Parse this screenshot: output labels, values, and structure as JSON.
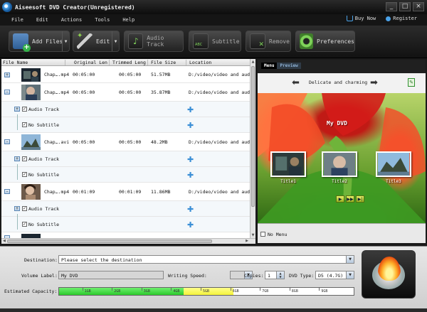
{
  "app": {
    "title": "Aiseesoft DVD Creator(Unregistered)"
  },
  "window_controls": {
    "minimize": "_",
    "maximize": "□",
    "close": "×"
  },
  "menu": {
    "items": [
      "File",
      "Edit",
      "Actions",
      "Tools",
      "Help"
    ],
    "buy_now": "Buy Now",
    "register": "Register"
  },
  "toolbar": {
    "add_files": "Add Files",
    "edit": "Edit",
    "audio_track": "Audio Track",
    "subtitle": "Subtitle",
    "remove": "Remove",
    "preferences": "Preferences"
  },
  "list": {
    "columns": [
      "File Name",
      "Original Len",
      "Trimmed Leng",
      "File Size",
      "Location"
    ],
    "rows": [
      {
        "kind": "file",
        "expander": "+",
        "name": "Chap….mp4",
        "original": "00:05:00",
        "trimmed": "00:05:00",
        "size": "51.57MB",
        "location": "D:/video/video and audi"
      },
      {
        "kind": "file",
        "expander": "–",
        "name": "Chap….mp4",
        "original": "00:05:00",
        "trimmed": "00:05:00",
        "size": "35.87MB",
        "location": "D:/video/video and audi"
      },
      {
        "kind": "track",
        "expander": "+",
        "label": "Audio Track"
      },
      {
        "kind": "track",
        "expander": "",
        "label": "No Subtitle"
      },
      {
        "kind": "file",
        "expander": "–",
        "name": "Chap….avi",
        "original": "00:05:00",
        "trimmed": "00:05:00",
        "size": "48.2MB",
        "location": "D:/video/video and audi"
      },
      {
        "kind": "track",
        "expander": "+",
        "label": "Audio Track"
      },
      {
        "kind": "track",
        "expander": "",
        "label": "No Subtitle"
      },
      {
        "kind": "file",
        "expander": "–",
        "name": "Chap….mp4",
        "original": "00:01:09",
        "trimmed": "00:01:09",
        "size": "11.86MB",
        "location": "D:/video/video and audi"
      },
      {
        "kind": "track",
        "expander": "+",
        "label": "Audio Track"
      },
      {
        "kind": "track",
        "expander": "",
        "label": "No Subtitle"
      }
    ]
  },
  "preview": {
    "tab_menu": "Menu",
    "tab_preview": "Preview",
    "template_name": "Delicate and charming",
    "dvd_title": "My DVD",
    "thumb_labels": [
      "Title1",
      "Title2",
      "Title3"
    ],
    "no_menu": "No Menu"
  },
  "bottom": {
    "destination_label": "Destination:",
    "destination_placeholder": "Please select the destination",
    "volume_label": "Volume Label:",
    "volume_value": "My DVD",
    "writing_speed_label": "Writing Speed:",
    "writing_speed_value": "",
    "copies_label": "Copies:",
    "copies_value": "1",
    "dvd_type_label": "DVD Type:",
    "dvd_type_value": "D5 (4.7G)",
    "estimated_capacity_label": "Estimated Capacity:",
    "capacity_ticks": [
      "1GB",
      "2GB",
      "3GB",
      "4GB",
      "5GB",
      "6GB",
      "7GB",
      "8GB",
      "9GB"
    ],
    "capacity_used_gb": 4.2,
    "capacity_warn_end_gb": 5.9,
    "capacity_max_gb": 10
  },
  "colors": {
    "accent": "#4aa2e8",
    "capacity_ok": "#1ec21e",
    "capacity_warn": "#f2f02a"
  }
}
